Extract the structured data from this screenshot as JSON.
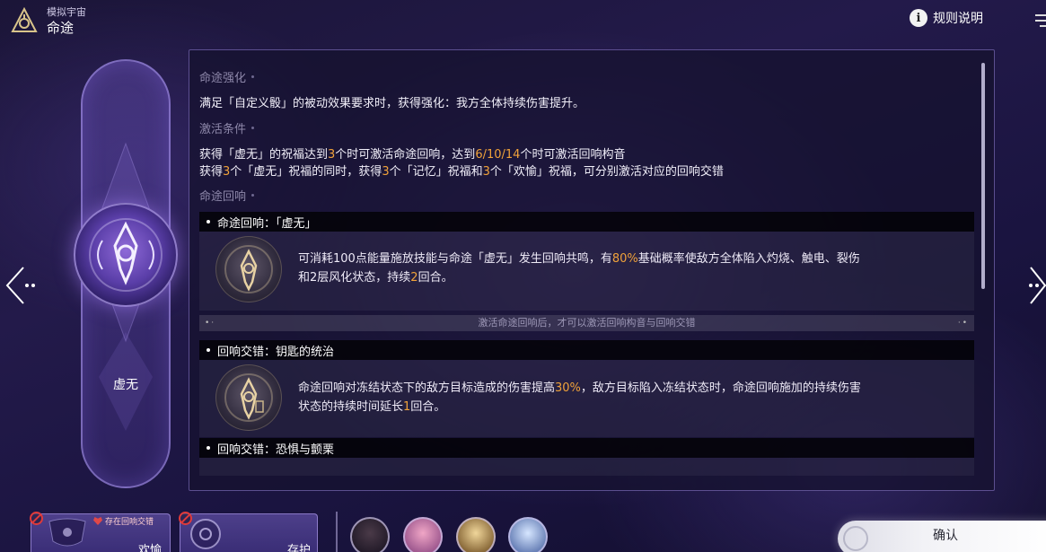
{
  "header": {
    "breadcrumb_small": "模拟宇宙",
    "title": "命途",
    "rules_label": "规则说明",
    "rules_icon": "info-icon"
  },
  "path": {
    "name": "虚无",
    "emblem_icon": "nihility-emblem-icon"
  },
  "sections": {
    "enhance": {
      "heading": "命途强化",
      "text": "满足「自定义骰」的被动效果要求时，获得强化：我方全体持续伤害提升。"
    },
    "activation": {
      "heading": "激活条件",
      "line1": {
        "a": "获得「虚无」的祝福达到",
        "b": "3",
        "c": "个时可激活命途回响，达到",
        "d": "6/10/14",
        "e": "个时可激活回响构音"
      },
      "line2": {
        "a": "获得",
        "b": "3",
        "c": "个「虚无」祝福的同时，获得",
        "d": "3",
        "e": "个「记忆」祝福和",
        "f": "3",
        "g": "个「欢愉」祝福，可分别激活对应的回响交错"
      }
    },
    "resonance": {
      "heading": "命途回响"
    }
  },
  "entries": {
    "resonance": {
      "title": "命途回响：「虚无」",
      "text1_a": "可消耗100点能量施放技能与命途「虚无」发生回响共鸣，有",
      "text1_b": "80%",
      "text1_c": "基础概率使敌方全体陷入灼烧、触电、裂伤",
      "text2_a": "和2层风化状态，持续",
      "text2_b": "2",
      "text2_c": "回合。"
    },
    "notice": "激活命途回响后，才可以激活回响构音与回响交错",
    "interplay1": {
      "title": "回响交错：钥匙的统治",
      "text1_a": "命途回响对冻结状态下的敌方目标造成的伤害提高",
      "text1_b": "30%",
      "text1_c": "，敌方目标陷入冻结状态时，命途回响施加的持续伤害",
      "text2_a": "状态的持续时间延长",
      "text2_b": "1",
      "text2_c": "回合。"
    },
    "interplay2": {
      "title": "回响交错：恐惧与颤栗"
    }
  },
  "bottom": {
    "slot1": {
      "label": "欢愉",
      "tag": "存在回响交错"
    },
    "slot2": {
      "label": "存护"
    },
    "confirm_label": "确认",
    "characters": [
      "character-1",
      "character-2",
      "character-3",
      "character-4"
    ]
  },
  "colors": {
    "highlight": "#f0a23a",
    "ban": "#e03a3a",
    "accent_purple": "#8f6ad8"
  }
}
